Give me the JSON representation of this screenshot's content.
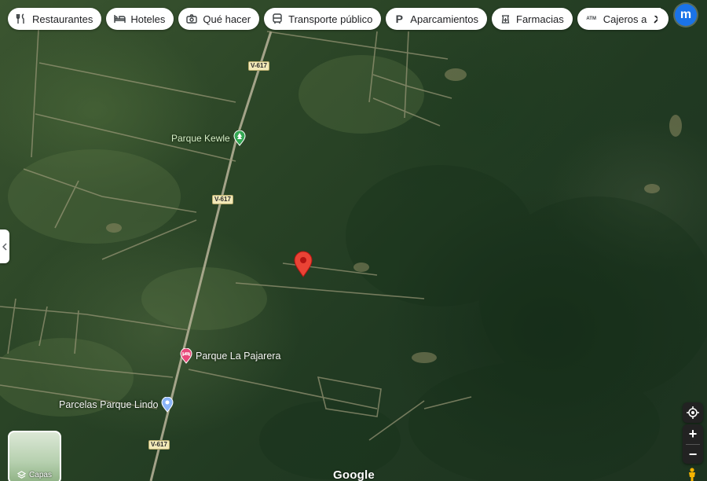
{
  "filter_chips": [
    {
      "label": "Restaurantes",
      "icon": "fork-knife-icon"
    },
    {
      "label": "Hoteles",
      "icon": "bed-icon"
    },
    {
      "label": "Qué hacer",
      "icon": "camera-icon"
    },
    {
      "label": "Transporte público",
      "icon": "bus-icon"
    },
    {
      "label": "Aparcamientos",
      "icon": "parking-icon"
    },
    {
      "label": "Farmacias",
      "icon": "pharmacy-icon"
    },
    {
      "label": "Cajeros a",
      "icon": "atm-icon",
      "icon_text": "ATM"
    }
  ],
  "header": {
    "avatar_letter": "m",
    "apps_icon": "grid-apps-icon",
    "accent": "#1a73e8"
  },
  "places": [
    {
      "name": "Parque Kewle",
      "icon": "park-pin-icon",
      "color": "#34a853"
    },
    {
      "name": "Parque La Pajarera",
      "icon": "hotel-pin-icon",
      "color": "#e8497a"
    },
    {
      "name": "Parcelas Parque Lindo",
      "icon": "place-pin-icon",
      "color": "#8ab4f8"
    }
  ],
  "road_labels": [
    "V-617",
    "V-617",
    "V-617"
  ],
  "selected_pin": {
    "icon": "red-location-pin-icon",
    "color": "#ea4335"
  },
  "layers": {
    "label": "Capas"
  },
  "controls": {
    "zoom_in": "+",
    "zoom_out": "−"
  },
  "logo": "Google"
}
